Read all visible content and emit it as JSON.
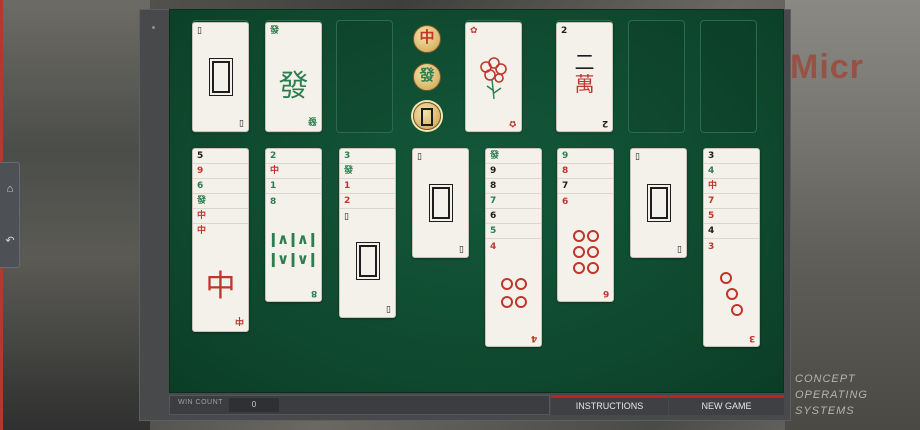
{
  "background": {
    "sign_text": "Micr",
    "caption_lines": [
      "CONCEPT",
      "OPERATING",
      "SYSTEMS"
    ]
  },
  "side_nav": {
    "items": [
      {
        "icon": "home-icon",
        "glyph": "⌂"
      },
      {
        "icon": "undo-icon",
        "glyph": "↶"
      }
    ]
  },
  "dragon_buttons": [
    {
      "icon": "red-dragon-icon",
      "glyph": "中",
      "color": "#c0362c"
    },
    {
      "icon": "green-dragon-icon",
      "glyph": "發",
      "color": "#2d7d4f"
    },
    {
      "icon": "white-dragon-icon",
      "glyph": "",
      "color": "#1d1d1d"
    }
  ],
  "top_row": {
    "free_cells": [
      {
        "index": "",
        "face": "white-dragon",
        "color": "black"
      },
      {
        "index": "發",
        "face": "發",
        "color": "green"
      },
      {
        "index": "",
        "face": "",
        "color": ""
      }
    ],
    "flower": {
      "index": "",
      "face": "flower-icon",
      "color": "red"
    },
    "foundations": [
      {
        "index": "2",
        "face": "二\n萬",
        "color": "black"
      },
      {
        "index": "",
        "face": "",
        "color": ""
      },
      {
        "index": "",
        "face": "",
        "color": ""
      }
    ]
  },
  "tableau": [
    {
      "strips": [
        "5",
        "9",
        "6",
        "發",
        "中",
        "中"
      ],
      "strip_colors": [
        "black",
        "red",
        "green",
        "green",
        "red",
        "red"
      ],
      "face": "中",
      "face_color": "red",
      "bottom_index": "中"
    },
    {
      "strips": [
        "2",
        "中",
        "1"
      ],
      "strip_colors": [
        "green",
        "red",
        "green"
      ],
      "face": "8 bamboo",
      "face_color": "green",
      "top_index": "8",
      "bottom_index": "8"
    },
    {
      "strips": [
        "3",
        "發",
        "1",
        "2"
      ],
      "strip_colors": [
        "green",
        "green",
        "red",
        "red"
      ],
      "face": "white-dragon",
      "face_color": "black",
      "bottom_index": ""
    },
    {
      "strips": [],
      "strip_colors": [],
      "face": "white-dragon",
      "face_color": "black",
      "top_index": "",
      "bottom_index": ""
    },
    {
      "strips": [
        "發",
        "9",
        "8",
        "7",
        "6",
        "5"
      ],
      "strip_colors": [
        "green",
        "black",
        "black",
        "green",
        "black",
        "green"
      ],
      "face": "4 circles",
      "face_color": "red",
      "top_index": "4",
      "bottom_index": "4"
    },
    {
      "strips": [
        "9",
        "8",
        "7"
      ],
      "strip_colors": [
        "green",
        "red",
        "black"
      ],
      "face": "6 circles",
      "face_color": "red",
      "top_index": "6",
      "bottom_index": "6"
    },
    {
      "strips": [],
      "strip_colors": [],
      "face": "white-dragon",
      "face_color": "black",
      "top_index": "",
      "bottom_index": ""
    },
    {
      "strips": [
        "3",
        "4",
        "中",
        "7",
        "5",
        "4"
      ],
      "strip_colors": [
        "black",
        "green",
        "red",
        "red",
        "red",
        "black"
      ],
      "face": "3 circles",
      "face_color": "red",
      "top_index": "3",
      "bottom_index": "3"
    }
  ],
  "footer": {
    "win_count_label": "WIN COUNT",
    "win_count_value": "0",
    "instructions_label": "INSTRUCTIONS",
    "new_game_label": "NEW GAME"
  },
  "colors": {
    "felt": "#0f4a2f",
    "accent": "#b8261d",
    "red": "#c0362c",
    "green": "#2d7d4f"
  }
}
